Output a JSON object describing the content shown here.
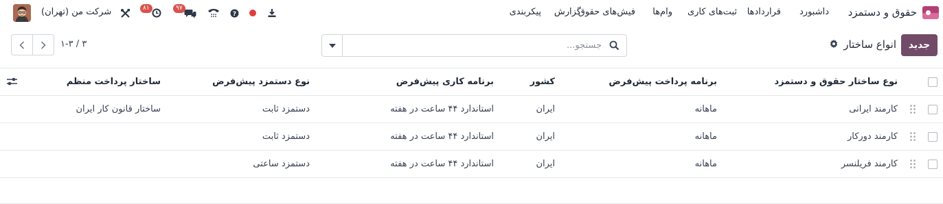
{
  "navbar": {
    "app_name": "حقوق و دستمزد",
    "menu": [
      "داشبورد",
      "قراردادها",
      "ثبت‌های کاری",
      "وام‌ها",
      "فیش‌های حقوق",
      "گزارش",
      "پیکربندی"
    ],
    "messages_badge": "۹۷",
    "activities_badge": "۸۱",
    "company": "شرکت من (تهران)",
    "icons": [
      "download-icon",
      "record-icon",
      "help-icon",
      "phone-icon",
      "chat-icon",
      "clock-icon",
      "tools-icon",
      "avatar"
    ]
  },
  "control": {
    "new_label": "جدید",
    "title": "انواع ساختار",
    "search_placeholder": "جستجو...",
    "pager": "۱-۳ / ۳"
  },
  "list": {
    "columns": [
      "نوع ساختار حقوق و دستمزد",
      "برنامه پرداخت پیش‌فرض",
      "کشور",
      "برنامه کاری پیش‌فرض",
      "نوع دستمزد پیش‌فرض",
      "ساختار پرداخت منظم"
    ],
    "rows": [
      [
        "کارمند ایرانی",
        "ماهانه",
        "ایران",
        "استاندارد ۴۴ ساعت در هفته",
        "دستمزد ثابت",
        "ساختار قانون کار ایران"
      ],
      [
        "کارمند دورکار",
        "ماهانه",
        "ایران",
        "استاندارد ۴۴ ساعت در هفته",
        "دستمزد ثابت",
        ""
      ],
      [
        "کارمند فریلنسر",
        "ماهانه",
        "ایران",
        "استاندارد ۴۴ ساعت در هفته",
        "دستمزد ساعتی",
        ""
      ]
    ]
  },
  "colors": {
    "accent": "#714B67",
    "badge": "#d9534f",
    "record": "#e03c3c"
  }
}
